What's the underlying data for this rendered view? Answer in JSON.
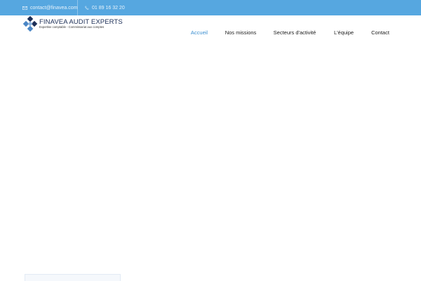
{
  "topbar": {
    "email": "contact@finavea.com",
    "phone": "01 89 16 32 20",
    "email_icon": "mail-icon",
    "phone_icon": "phone-icon"
  },
  "logo": {
    "title": "FINAVEA AUDIT EXPERTS",
    "tagline": "Expertise comptable - Commissariat aux comptes"
  },
  "nav": {
    "items": [
      {
        "label": "Accueil",
        "active": true
      },
      {
        "label": "Nos missions",
        "active": false
      },
      {
        "label": "Secteurs d'activité",
        "active": false
      },
      {
        "label": "L'équipe",
        "active": false
      },
      {
        "label": "Contact",
        "active": false
      }
    ]
  },
  "colors": {
    "topbar": "#56a7e0",
    "accent": "#3b8fd0",
    "logo_dark": "#1d2f57"
  }
}
